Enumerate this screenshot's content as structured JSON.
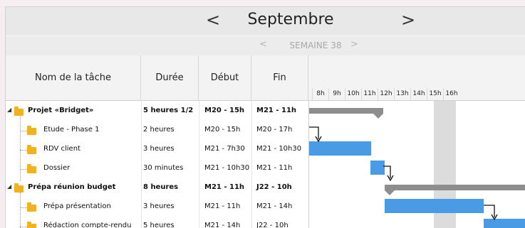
{
  "header": {
    "month": "Septembre",
    "prev": "<",
    "next": ">"
  },
  "week": {
    "label": "SEMAINE 38",
    "prev": "<",
    "next": ">"
  },
  "columns": {
    "task": "Nom de la tâche",
    "duration": "Durée",
    "start": "Début",
    "end": "Fin"
  },
  "hours": [
    "8h",
    "9h",
    "10h",
    "11h",
    "12h",
    "13h",
    "14h",
    "15h",
    "16h"
  ],
  "tasks": [
    {
      "name": "Projet «Bridget»",
      "duration": "5 heures 1/2",
      "start": "M20 - 15h",
      "end": "M21 - 11h",
      "summary": true
    },
    {
      "name": "Etude - Phase 1",
      "duration": "2 heures",
      "start": "M20 - 15h",
      "end": "M20 - 17h",
      "summary": false
    },
    {
      "name": "RDV client",
      "duration": "3 heures",
      "start": "M21 - 7h30",
      "end": "M21 - 10h30",
      "summary": false
    },
    {
      "name": "Dossier",
      "duration": "30 minutes",
      "start": "M21 - 10h30",
      "end": "M21 - 11h",
      "summary": false
    },
    {
      "name": "Prépa réunion budget",
      "duration": "8 heures",
      "start": "M21 - 11h",
      "end": "J22 - 10h",
      "summary": true
    },
    {
      "name": "Prépa présentation",
      "duration": "3 heures",
      "start": "M21 - 11h",
      "end": "M21 - 14h",
      "summary": false
    },
    {
      "name": "Rédaction compte-rendu",
      "duration": "5 heures",
      "start": "M21 - 14h",
      "end": "J22 - 10h",
      "summary": false
    }
  ]
}
